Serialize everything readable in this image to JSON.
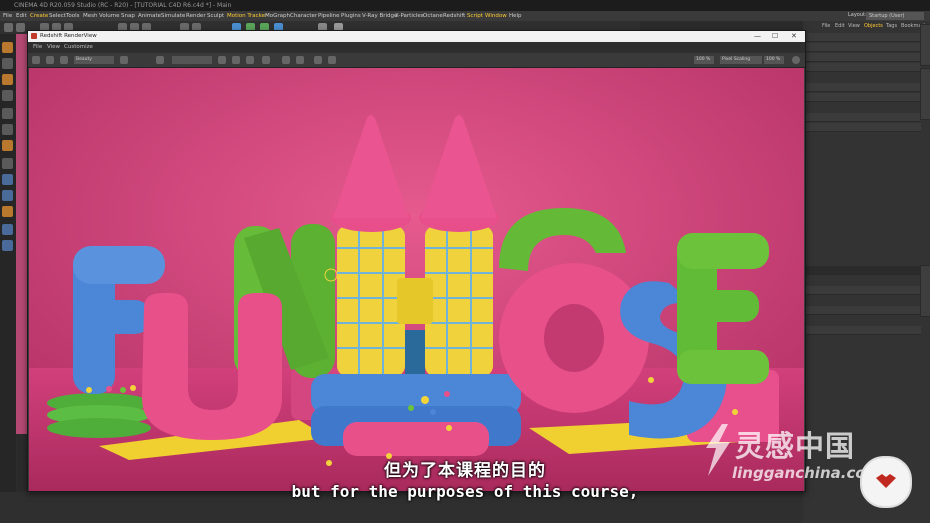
{
  "app": {
    "title": "CINEMA 4D R20.059 Studio (RC - R20) - [TUTORIAL C4D R6.c4d *] - Main",
    "menu": [
      "File",
      "Edit",
      "Create",
      "Select",
      "Tools",
      "Mesh",
      "Volume",
      "Snap",
      "Animate",
      "Simulate",
      "Render",
      "Sculpt",
      "Motion Tracker",
      "MoGraph",
      "Character",
      "Pipeline",
      "Plugins",
      "V-Ray Bridge",
      "X-Particles",
      "Octane",
      "Redshift",
      "Script",
      "Window",
      "Help"
    ],
    "layout_label": "Layout:",
    "layout_value": "Startup (User)",
    "objects_tabs": [
      "File",
      "Edit",
      "View",
      "Objects",
      "Tags",
      "Bookmarks"
    ]
  },
  "renderview": {
    "title": "Redshift RenderView",
    "window_controls": [
      "—",
      "☐",
      "✕"
    ],
    "menu": [
      "File",
      "View",
      "Customize"
    ],
    "aov_select": "Beauty",
    "zoom_left": "100 %",
    "scaling": "Pixel Scaling",
    "zoom_right": "100 %"
  },
  "subtitles": {
    "chinese": "但为了本课程的目的",
    "english": "but for the purposes of this course,"
  },
  "watermark": {
    "cn": "灵感中国",
    "en": "lingganchina.com"
  },
  "colors": {
    "background": "#cf3f78",
    "pink_letter": "#e8508a",
    "blue_letter": "#4a86d8",
    "green_letter": "#6cc23a",
    "yellow": "#f2d43a"
  },
  "icons": {
    "renderview_app": "redshift-icon",
    "badge": "heart-badge-icon"
  }
}
